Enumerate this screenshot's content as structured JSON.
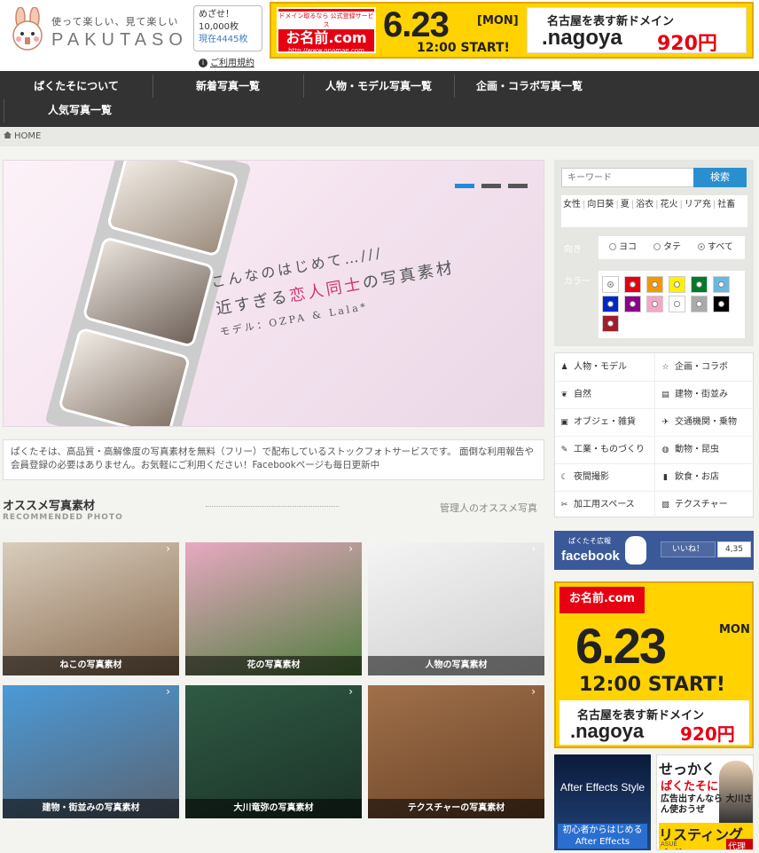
{
  "header": {
    "tagline": "使って楽しい、見て楽しい",
    "brand": "PAKUTASO",
    "counter": {
      "line1": "めざせ！",
      "line2": "10,000枚",
      "line3": "現在4445枚"
    },
    "terms": "ご利用規約"
  },
  "top_banner": {
    "red_top": "ドメイン取るなら 公式登録サービス",
    "red_main": "お名前.com",
    "red_url": "http://www.onamae.com",
    "date": "6.23",
    "weekday": "[MON]",
    "start": "12:00 START!",
    "headline": "名古屋を表す新ドメイン",
    "domain": ".nagoya",
    "price": "920円"
  },
  "nav": {
    "items": [
      "ぱくたそについて",
      "新着写真一覧",
      "人物・モデル写真一覧",
      "企画・コラボ写真一覧",
      "人気写真一覧"
    ]
  },
  "breadcrumb": {
    "home": "HOME"
  },
  "slider": {
    "line1": "こんなのはじめて…///",
    "line2a": "近すぎる",
    "line2b": "恋人同士",
    "line2c": "の写真素材",
    "line3": "モデル：OZPA & Lala*"
  },
  "intro": "ぱくたそは、高品質・高解像度の写真素材を無料（フリー）で配布しているストックフォトサービスです。 面倒な利用報告や会員登録の必要はありません。お気軽にご利用ください！Facebookページも毎日更新中",
  "recommend": {
    "title": "オススメ写真素材",
    "subtitle": "RECOMMENDED PHOTO",
    "link": "管理人のオススメ写真",
    "tiles": [
      {
        "caption": "ねこの写真素材",
        "colors": [
          "#d9cdbd",
          "#8a6d52"
        ]
      },
      {
        "caption": "花の写真素材",
        "colors": [
          "#e8a9c2",
          "#4f7d3d"
        ]
      },
      {
        "caption": "人物の写真素材",
        "colors": [
          "#f4f4f4",
          "#cfcfcf"
        ]
      },
      {
        "caption": "建物・街並みの写真素材",
        "colors": [
          "#4b9ad8",
          "#5a6370"
        ]
      },
      {
        "caption": "大川竜弥の写真素材",
        "colors": [
          "#2f5a43",
          "#1c3328"
        ]
      },
      {
        "caption": "テクスチャーの写真素材",
        "colors": [
          "#a0704a",
          "#6b4428"
        ]
      }
    ]
  },
  "sidebar": {
    "search_placeholder": "キーワード",
    "search_button": "検索",
    "tags": [
      "女性",
      "向日葵",
      "夏",
      "浴衣",
      "花火",
      "リア充",
      "社畜"
    ],
    "orientation_label": "向き",
    "orientation_options": [
      "ヨコ",
      "タテ",
      "すべて"
    ],
    "orientation_selected": "すべて",
    "color_label": "カラー",
    "colors": [
      "#ffffff",
      "#e60012",
      "#f39800",
      "#fff100",
      "#007a2b",
      "#68b9de",
      "#0028c8",
      "#8a008a",
      "#f4a6c6",
      "#ffffff",
      "#aaaaaa",
      "#000000",
      "#a01e2c"
    ],
    "categories": [
      {
        "label": "人物・モデル",
        "icon": "person-icon",
        "glyph": "♟"
      },
      {
        "label": "企画・コラボ",
        "icon": "star-icon",
        "glyph": "☆"
      },
      {
        "label": "自然",
        "icon": "leaf-icon",
        "glyph": "❦"
      },
      {
        "label": "建物・街並み",
        "icon": "building-icon",
        "glyph": "▤"
      },
      {
        "label": "オブジェ・雑貨",
        "icon": "cube-icon",
        "glyph": "▣"
      },
      {
        "label": "交通機関・乗物",
        "icon": "plane-icon",
        "glyph": "✈"
      },
      {
        "label": "工業・ものづくり",
        "icon": "wrench-icon",
        "glyph": "✎"
      },
      {
        "label": "動物・昆虫",
        "icon": "globe-icon",
        "glyph": "◍"
      },
      {
        "label": "夜間撮影",
        "icon": "moon-icon",
        "glyph": "☾"
      },
      {
        "label": "飲食・お店",
        "icon": "cup-icon",
        "glyph": "▮"
      },
      {
        "label": "加工用スペース",
        "icon": "scissors-icon",
        "glyph": "✂"
      },
      {
        "label": "テクスチャー",
        "icon": "image-icon",
        "glyph": "▧"
      }
    ]
  },
  "facebook": {
    "small": "ぱくたそ広報",
    "name": "facebook",
    "like": "いいね！",
    "count": "4,35"
  },
  "side_ad": {
    "red": "お名前.com",
    "date": "6.23",
    "weekday": "MON",
    "start": "12:00 START!",
    "headline": "名古屋を表す新ドメイン",
    "domain": ".nagoya",
    "price": "920円"
  },
  "ae_ad": {
    "title": "After Effects Style",
    "sub1": "初心者からはじめる",
    "sub2": "After Effects"
  },
  "listing_ad": {
    "l1": "せっかく",
    "l2": "ぱくたそに",
    "l3": "広告出すんなら 大川さん使おうぜ",
    "l4": "リスティング広告",
    "l5": "ASUE",
    "l6": "代理店"
  }
}
